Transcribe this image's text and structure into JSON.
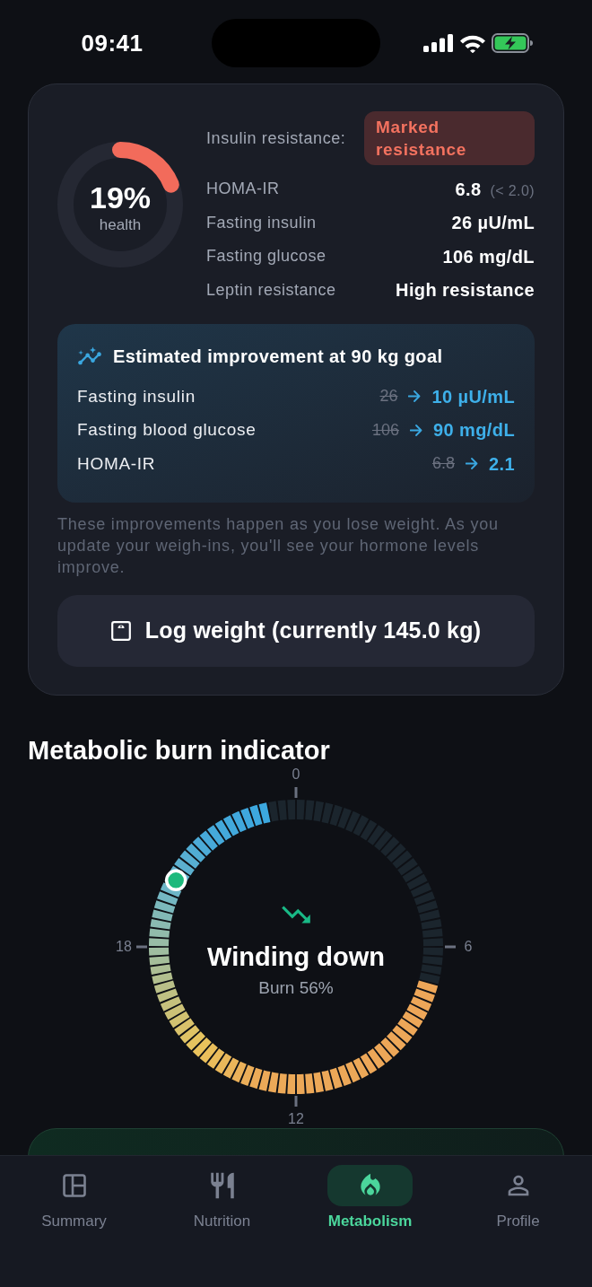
{
  "status_bar": {
    "time": "09:41"
  },
  "health_card": {
    "ring": {
      "value": "19%",
      "caption": "health",
      "level": 0.19
    },
    "insulin_resistance": {
      "label": "Insulin resistance:",
      "badge": "Marked resistance"
    },
    "metrics": [
      {
        "label": "HOMA-IR",
        "value": "6.8",
        "reference": "(< 2.0)"
      },
      {
        "label": "Fasting insulin",
        "value": "26 µU/mL"
      },
      {
        "label": "Fasting glucose",
        "value": "106 mg/dL"
      },
      {
        "label": "Leptin resistance",
        "value": "High resistance"
      }
    ],
    "improvement": {
      "title": "Estimated improvement at 90 kg goal",
      "rows": [
        {
          "label": "Fasting insulin",
          "current": "26",
          "target": "10 µU/mL"
        },
        {
          "label": "Fasting blood glucose",
          "current": "106",
          "target": "90 mg/dL"
        },
        {
          "label": "HOMA-IR",
          "current": "6.8",
          "target": "2.1"
        }
      ]
    },
    "note": "These improvements happen as you lose weight. As you update your weigh-ins, you'll see your hormone levels improve.",
    "log_button": "Log weight (currently 145.0 kg)"
  },
  "burn_indicator": {
    "title": "Metabolic burn indicator",
    "hour_labels": [
      "0",
      "6",
      "12",
      "18"
    ],
    "status": "Winding down",
    "reading": "Burn 56%"
  },
  "nav": [
    {
      "label": "Summary",
      "selected": false
    },
    {
      "label": "Nutrition",
      "selected": false
    },
    {
      "label": "Metabolism",
      "selected": true
    },
    {
      "label": "Profile",
      "selected": false
    }
  ]
}
